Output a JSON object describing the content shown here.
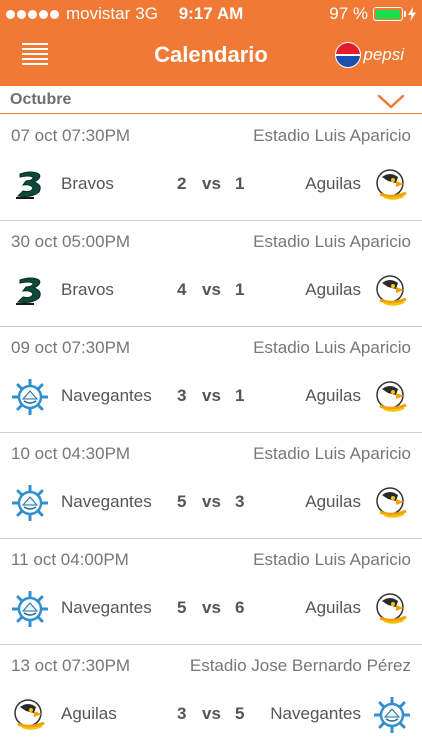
{
  "status_bar": {
    "carrier": "movistar",
    "network": "3G",
    "time": "9:17 AM",
    "battery": "97 %",
    "battery_level": 0.97
  },
  "header": {
    "title": "Calendario",
    "sponsor": "pepsi",
    "color": "#f07a35"
  },
  "month": {
    "label": "Octubre"
  },
  "games": [
    {
      "date": "07 oct 07:30PM",
      "stadium": "Estadio Luis Aparicio",
      "home": "Bravos",
      "home_icon": "bravos-logo-icon",
      "home_score": "2",
      "vs": "vs",
      "away_score": "1",
      "away": "Aguilas",
      "away_icon": "aguilas-logo-icon"
    },
    {
      "date": "30 oct 05:00PM",
      "stadium": "Estadio Luis Aparicio",
      "home": "Bravos",
      "home_icon": "bravos-logo-icon",
      "home_score": "4",
      "vs": "vs",
      "away_score": "1",
      "away": "Aguilas",
      "away_icon": "aguilas-logo-icon"
    },
    {
      "date": "09 oct 07:30PM",
      "stadium": "Estadio Luis Aparicio",
      "home": "Navegantes",
      "home_icon": "navegantes-logo-icon",
      "home_score": "3",
      "vs": "vs",
      "away_score": "1",
      "away": "Aguilas",
      "away_icon": "aguilas-logo-icon"
    },
    {
      "date": "10 oct 04:30PM",
      "stadium": "Estadio Luis Aparicio",
      "home": "Navegantes",
      "home_icon": "navegantes-logo-icon",
      "home_score": "5",
      "vs": "vs",
      "away_score": "3",
      "away": "Aguilas",
      "away_icon": "aguilas-logo-icon"
    },
    {
      "date": "11 oct 04:00PM",
      "stadium": "Estadio Luis Aparicio",
      "home": "Navegantes",
      "home_icon": "navegantes-logo-icon",
      "home_score": "5",
      "vs": "vs",
      "away_score": "6",
      "away": "Aguilas",
      "away_icon": "aguilas-logo-icon"
    },
    {
      "date": "13 oct 07:30PM",
      "stadium": "Estadio Jose Bernardo Pérez",
      "home": "Aguilas",
      "home_icon": "aguilas-logo-icon",
      "home_score": "3",
      "vs": "vs",
      "away_score": "5",
      "away": "Navegantes",
      "away_icon": "navegantes-logo-icon"
    }
  ]
}
